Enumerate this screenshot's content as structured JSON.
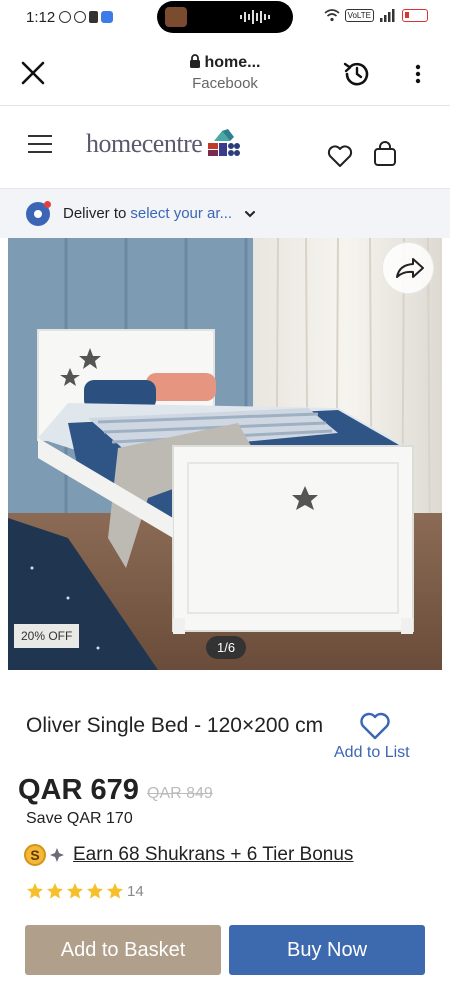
{
  "status_bar": {
    "time": "1:12",
    "network_badge": "VoLTE"
  },
  "browser": {
    "domain": "home...",
    "site_name": "Facebook"
  },
  "site": {
    "logo_text": "homecentre"
  },
  "delivery": {
    "prefix": "Deliver to",
    "link_text": "select your ar..."
  },
  "product_image": {
    "discount_badge": "20% OFF",
    "image_counter": "1/6"
  },
  "product": {
    "title": "Oliver Single Bed - 120×200 cm",
    "wishlist_label": "Add to List",
    "price": "QAR 679",
    "original_price": "QAR 849",
    "savings": "Save QAR 170",
    "shukran_coin": "S",
    "shukran_text": "Earn 68 Shukrans +  6  Tier Bonus",
    "rating": 5,
    "rating_count": "14"
  },
  "actions": {
    "add_to_basket": "Add to Basket",
    "buy_now": "Buy Now"
  },
  "colors": {
    "accent_blue": "#3d69ae",
    "basket_tan": "#b09f8a",
    "star_gold": "#f5c02a"
  }
}
